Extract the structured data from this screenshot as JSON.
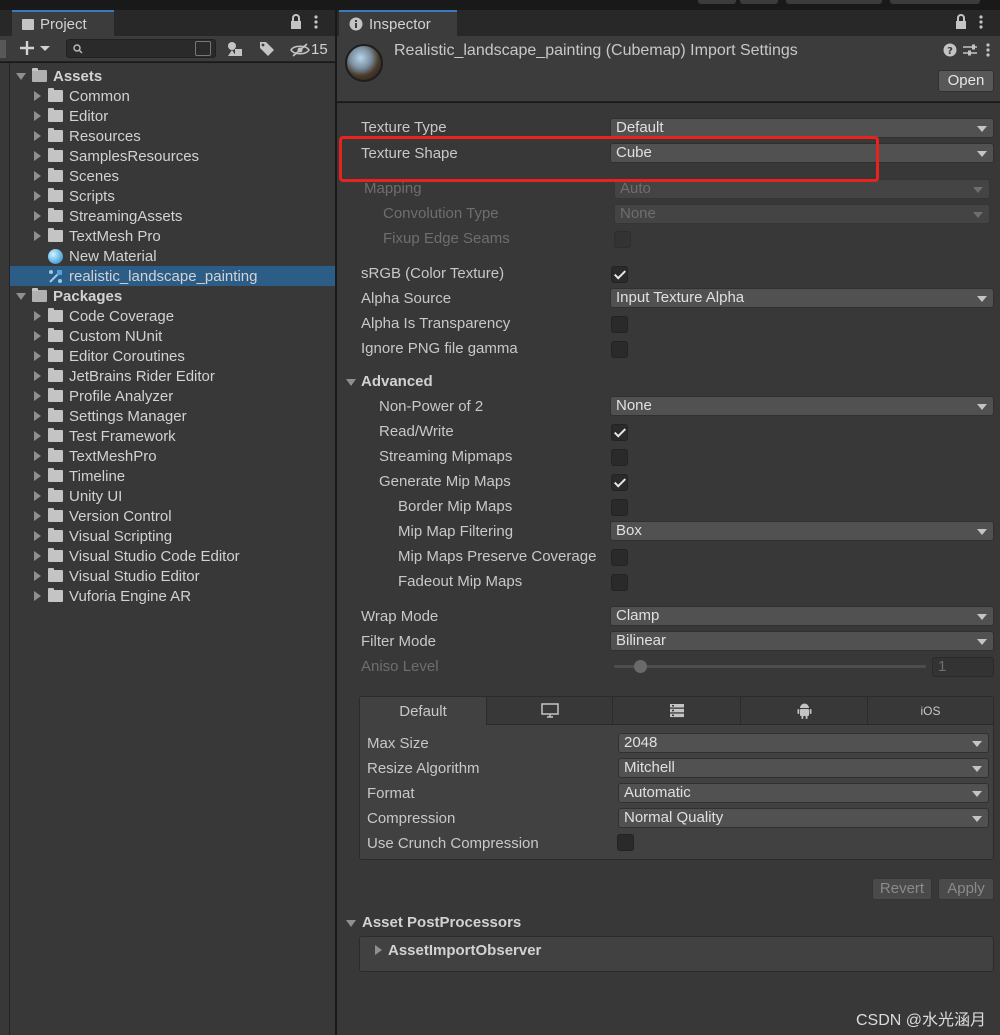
{
  "project": {
    "tab_label": "Project",
    "hidden_count": "15",
    "tree": [
      {
        "label": "Assets",
        "bold": true,
        "depth": 0,
        "expanded": true
      },
      {
        "label": "Common",
        "depth": 1
      },
      {
        "label": "Editor",
        "depth": 1
      },
      {
        "label": "Resources",
        "depth": 1
      },
      {
        "label": "SamplesResources",
        "depth": 1
      },
      {
        "label": "Scenes",
        "depth": 1
      },
      {
        "label": "Scripts",
        "depth": 1
      },
      {
        "label": "StreamingAssets",
        "depth": 1
      },
      {
        "label": "TextMesh Pro",
        "depth": 1
      },
      {
        "label": "New Material",
        "depth": 1,
        "icon": "material-sphere-icon"
      },
      {
        "label": "realistic_landscape_painting",
        "depth": 1,
        "icon": "texture-asset-icon",
        "selected": true
      },
      {
        "label": "Packages",
        "bold": true,
        "depth": 0,
        "expanded": true
      },
      {
        "label": "Code Coverage",
        "depth": 1
      },
      {
        "label": "Custom NUnit",
        "depth": 1
      },
      {
        "label": "Editor Coroutines",
        "depth": 1
      },
      {
        "label": "JetBrains Rider Editor",
        "depth": 1
      },
      {
        "label": "Profile Analyzer",
        "depth": 1
      },
      {
        "label": "Settings Manager",
        "depth": 1
      },
      {
        "label": "Test Framework",
        "depth": 1
      },
      {
        "label": "TextMeshPro",
        "depth": 1
      },
      {
        "label": "Timeline",
        "depth": 1
      },
      {
        "label": "Unity UI",
        "depth": 1
      },
      {
        "label": "Version Control",
        "depth": 1
      },
      {
        "label": "Visual Scripting",
        "depth": 1
      },
      {
        "label": "Visual Studio Code Editor",
        "depth": 1
      },
      {
        "label": "Visual Studio Editor",
        "depth": 1
      },
      {
        "label": "Vuforia Engine AR",
        "depth": 1
      }
    ]
  },
  "inspector": {
    "tab_label": "Inspector",
    "title": "Realistic_landscape_painting (Cubemap) Import Settings",
    "open_button": "Open",
    "texture_type": {
      "label": "Texture Type",
      "value": "Default"
    },
    "texture_shape": {
      "label": "Texture Shape",
      "value": "Cube"
    },
    "mapping": {
      "label": "Mapping",
      "value": "Auto"
    },
    "convolution_type": {
      "label": "Convolution Type",
      "value": "None"
    },
    "fixup_edge_seams": {
      "label": "Fixup Edge Seams",
      "checked": false
    },
    "srgb": {
      "label": "sRGB (Color Texture)",
      "checked": true
    },
    "alpha_source": {
      "label": "Alpha Source",
      "value": "Input Texture Alpha"
    },
    "alpha_is_transparency": {
      "label": "Alpha Is Transparency",
      "checked": false
    },
    "ignore_png_gamma": {
      "label": "Ignore PNG file gamma",
      "checked": false
    },
    "advanced": {
      "label": "Advanced",
      "non_power_of_2": {
        "label": "Non-Power of 2",
        "value": "None"
      },
      "read_write": {
        "label": "Read/Write",
        "checked": true
      },
      "streaming_mipmaps": {
        "label": "Streaming Mipmaps",
        "checked": false
      },
      "generate_mip_maps": {
        "label": "Generate Mip Maps",
        "checked": true
      },
      "border_mip_maps": {
        "label": "Border Mip Maps",
        "checked": false
      },
      "mip_map_filtering": {
        "label": "Mip Map Filtering",
        "value": "Box"
      },
      "mip_maps_preserve_coverage": {
        "label": "Mip Maps Preserve Coverage",
        "checked": false
      },
      "fadeout_mip_maps": {
        "label": "Fadeout Mip Maps",
        "checked": false
      }
    },
    "wrap_mode": {
      "label": "Wrap Mode",
      "value": "Clamp"
    },
    "filter_mode": {
      "label": "Filter Mode",
      "value": "Bilinear"
    },
    "aniso_level": {
      "label": "Aniso Level",
      "value": "1",
      "slider_fraction": 0.02
    },
    "platform": {
      "tabs": [
        {
          "label": "Default",
          "icon": null,
          "active": true
        },
        {
          "label": "",
          "icon": "monitor-icon"
        },
        {
          "label": "",
          "icon": "server-icon"
        },
        {
          "label": "",
          "icon": "android-icon"
        },
        {
          "label": "iOS",
          "icon": null
        }
      ],
      "max_size": {
        "label": "Max Size",
        "value": "2048"
      },
      "resize_algorithm": {
        "label": "Resize Algorithm",
        "value": "Mitchell"
      },
      "format": {
        "label": "Format",
        "value": "Automatic"
      },
      "compression": {
        "label": "Compression",
        "value": "Normal Quality"
      },
      "use_crunch": {
        "label": "Use Crunch Compression",
        "checked": false
      }
    },
    "revert_button": "Revert",
    "apply_button": "Apply",
    "asset_postprocessors": {
      "label": "Asset PostProcessors",
      "item": "AssetImportObserver"
    }
  },
  "watermark": "CSDN @水光涵月",
  "colors": {
    "selection": "#2c5d87",
    "highlight_box": "#e8221c",
    "tab_accent": "#3a79bb"
  }
}
